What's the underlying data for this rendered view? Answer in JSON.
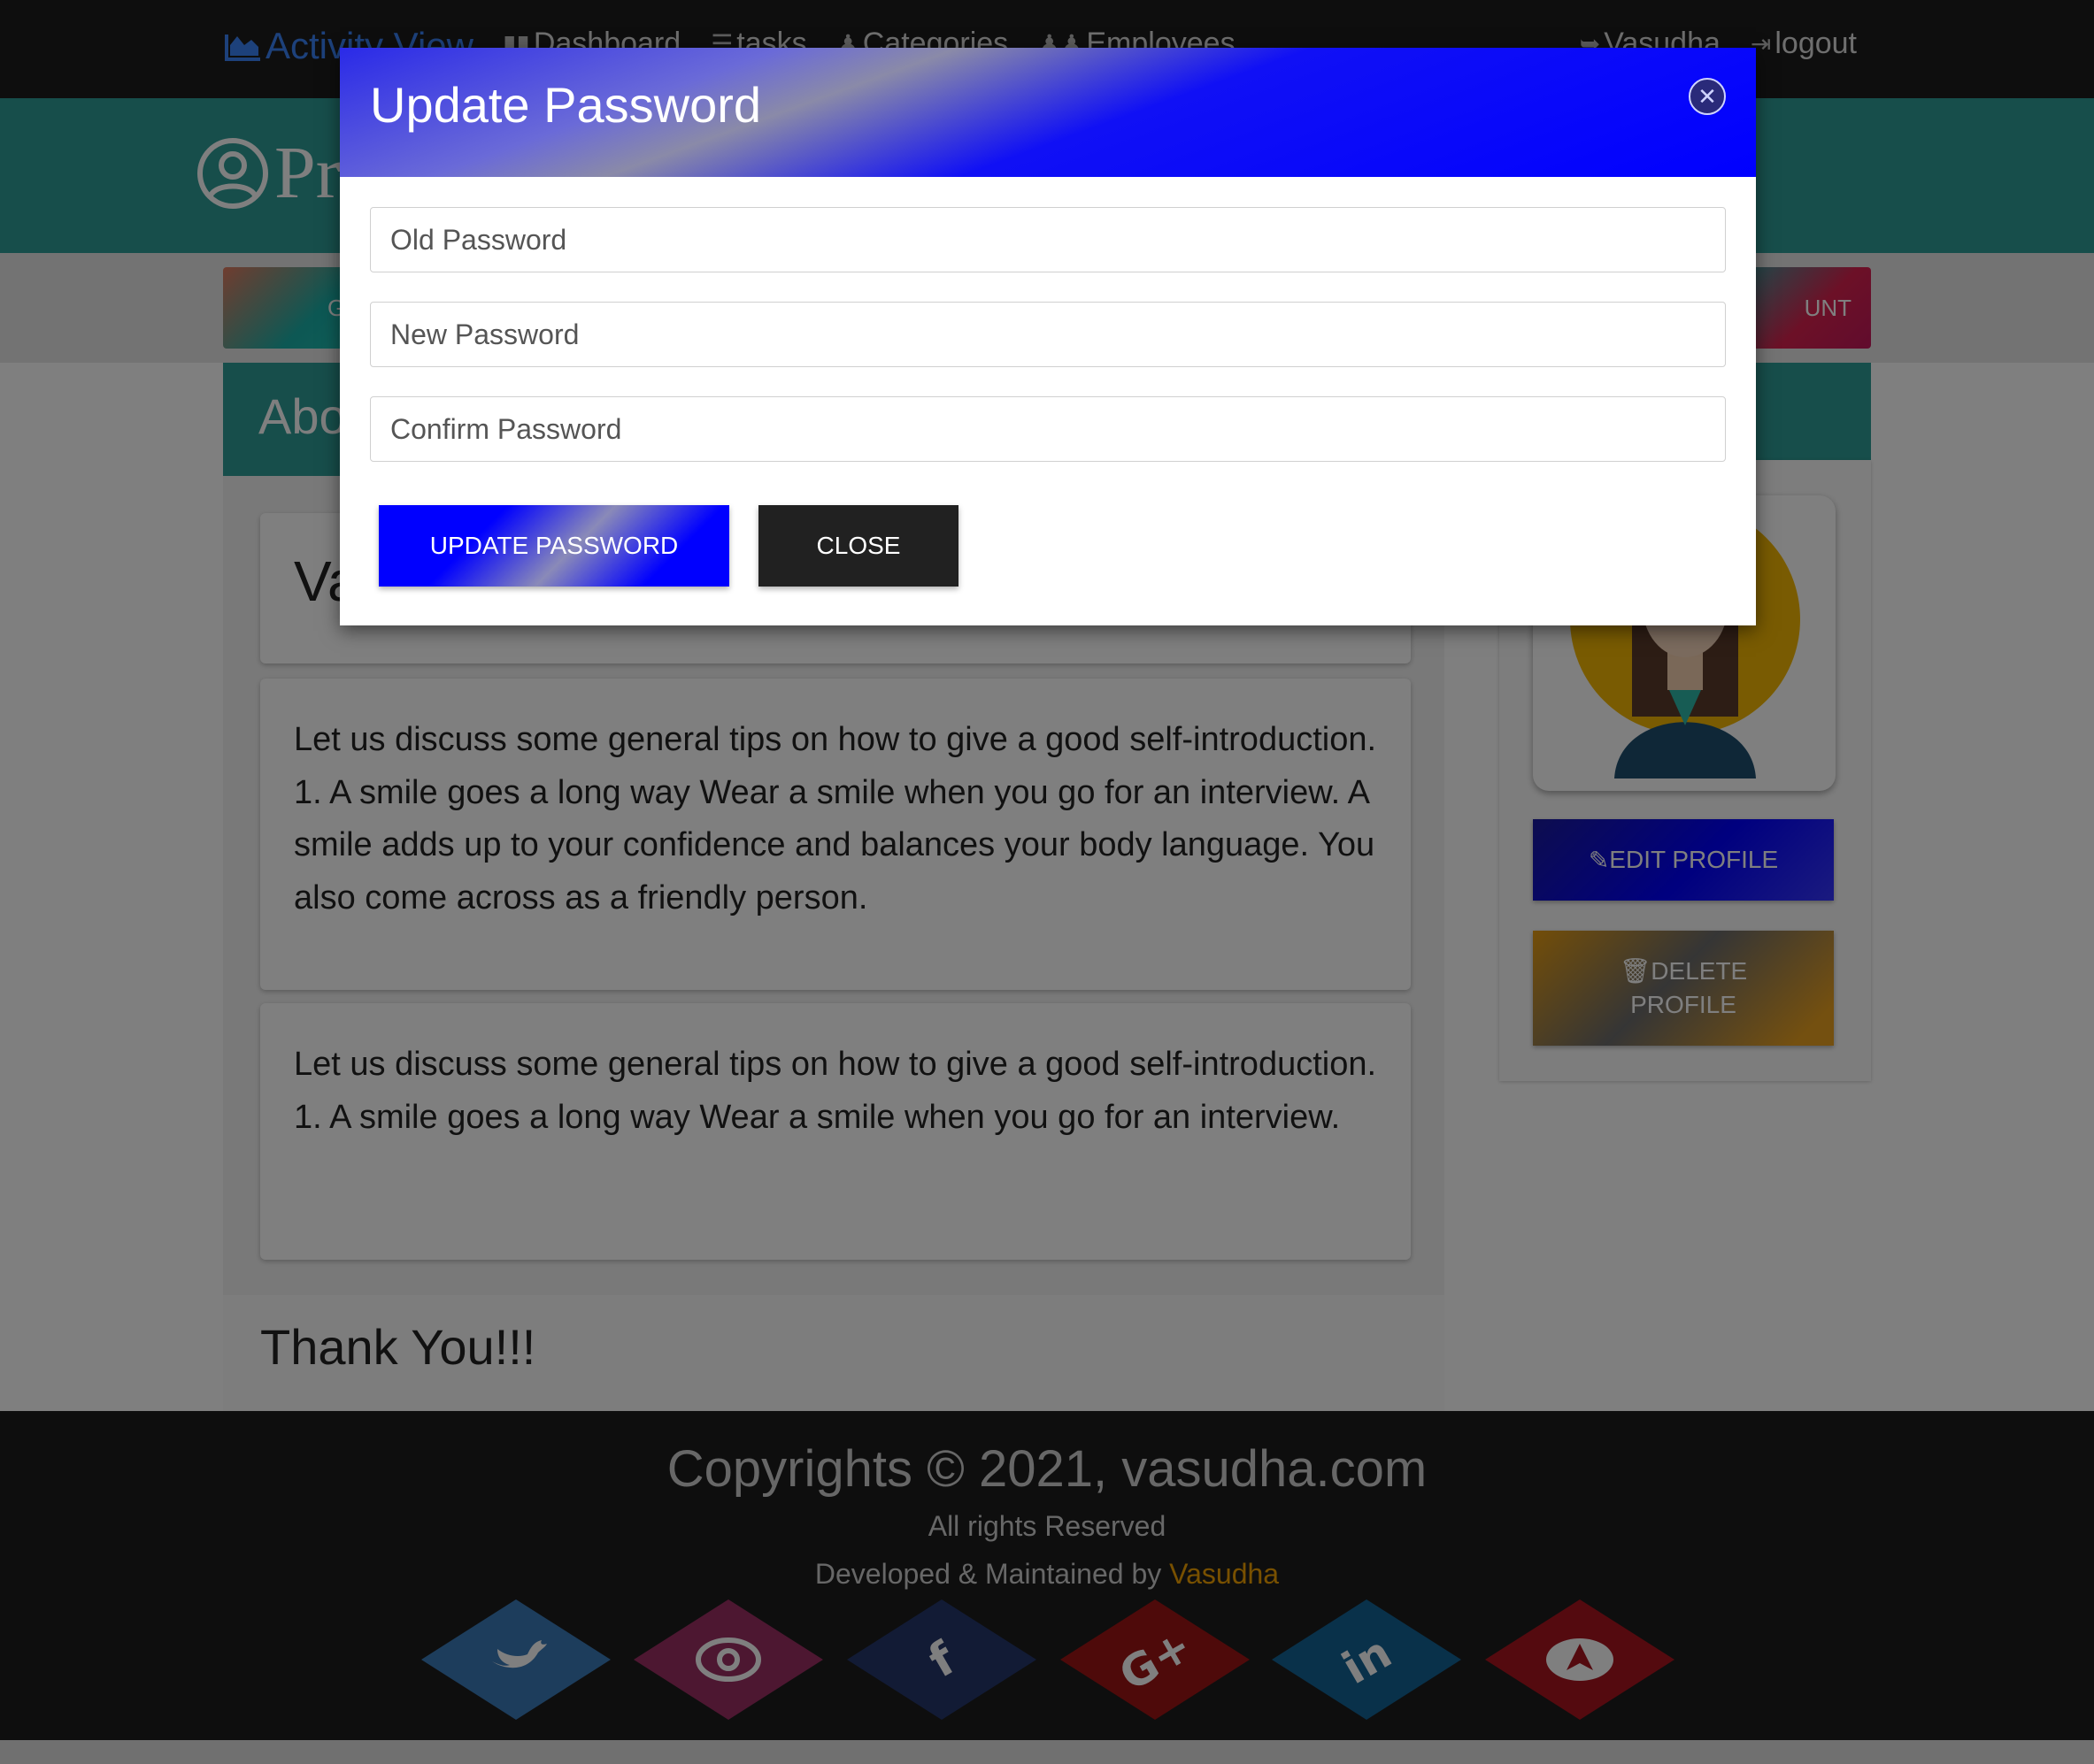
{
  "navbar": {
    "brand": "Activity View",
    "links": [
      "Dashboard",
      "tasks",
      "Categories",
      "Employees"
    ],
    "user": "Vasudha",
    "logout": "logout"
  },
  "header": {
    "title": "Profile"
  },
  "tabs": {
    "left_fragment": "G",
    "right_fragment": "UNT"
  },
  "about": {
    "heading": "About",
    "name": "Vasudha",
    "para1": "Let us discuss some general tips on how to give a good self-introduction. 1. A smile goes a long way Wear a smile when you go for an interview. A smile adds up to your confidence and balances your body language. You also come across as a friendly person.",
    "para2": "Let us discuss some general tips on how to give a good self-introduction. 1. A smile goes a long way Wear a smile when you go for an interview.",
    "thanks": "Thank You!!!"
  },
  "sidebar": {
    "edit_label": "EDIT PROFILE",
    "delete_label_line1": "DELETE",
    "delete_label_line2": "PROFILE"
  },
  "footer": {
    "copyright": "Copyrights © 2021, vasudha.com",
    "rights": "All rights Reserved",
    "developed_prefix": "Developed & Maintained by ",
    "developer": "Vasudha",
    "social": [
      {
        "name": "twitter",
        "color": "#3a7ab8"
      },
      {
        "name": "instagram",
        "color": "#9b2f63"
      },
      {
        "name": "facebook",
        "color": "#24366b"
      },
      {
        "name": "google-plus",
        "color": "#9c1414"
      },
      {
        "name": "linkedin",
        "color": "#136294"
      },
      {
        "name": "send",
        "color": "#a8141e"
      }
    ]
  },
  "modal": {
    "title": "Update Password",
    "old_placeholder": "Old Password",
    "new_placeholder": "New Password",
    "confirm_placeholder": "Confirm Password",
    "update_label": "UPDATE PASSWORD",
    "close_label": "CLOSE"
  }
}
